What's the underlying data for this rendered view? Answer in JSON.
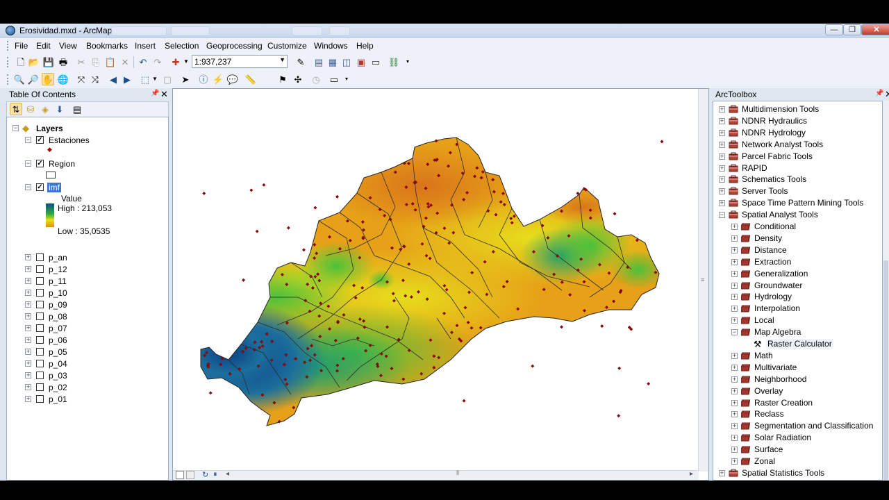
{
  "window": {
    "title": "Erosividad.mxd - ArcMap",
    "minimize": "0",
    "maximize": "1",
    "close": "r"
  },
  "menu": [
    "File",
    "Edit",
    "View",
    "Bookmarks",
    "Insert",
    "Selection",
    "Geoprocessing",
    "Customize",
    "Windows",
    "Help"
  ],
  "toolbar": {
    "scale": "1:937,237"
  },
  "toc": {
    "title": "Table Of Contents",
    "group": "Layers",
    "layers": [
      {
        "name": "Estaciones",
        "checked": true
      },
      {
        "name": "Region",
        "checked": true
      },
      {
        "name": "imf",
        "checked": true,
        "legend": {
          "field": "Value",
          "high": "High : 213,053",
          "low": "Low : 35,0535"
        }
      }
    ],
    "other_layers": [
      "p_an",
      "p_12",
      "p_11",
      "p_10",
      "p_09",
      "p_08",
      "p_07",
      "p_06",
      "p_05",
      "p_04",
      "p_03",
      "p_02",
      "p_01"
    ]
  },
  "arctoolbox": {
    "title": "ArcToolbox",
    "toolboxes_top": [
      "Multidimension Tools",
      "NDNR Hydraulics",
      "NDNR Hydrology",
      "Network Analyst Tools",
      "Parcel Fabric Tools",
      "RAPID",
      "Schematics Tools",
      "Server Tools",
      "Space Time Pattern Mining Tools"
    ],
    "spatial_analyst": "Spatial Analyst Tools",
    "sa_before": [
      "Conditional",
      "Density",
      "Distance",
      "Extraction",
      "Generalization",
      "Groundwater",
      "Hydrology",
      "Interpolation",
      "Local"
    ],
    "map_algebra": "Map Algebra",
    "raster_calculator": "Raster Calculator",
    "sa_after": [
      "Math",
      "Multivariate",
      "Neighborhood",
      "Overlay",
      "Raster Creation",
      "Reclass",
      "Segmentation and Classification",
      "Solar Radiation",
      "Surface",
      "Zonal"
    ],
    "toolboxes_bottom": [
      "Spatial Statistics Tools"
    ]
  },
  "colors": {
    "legend_high": "#0a4f8a",
    "legend_mid": "#2fae3a",
    "legend_low": "#e08a10",
    "station": "#a00000"
  },
  "icons": [
    "search-icon",
    "pan-icon",
    "identify-icon",
    "pin-icon",
    "close-icon"
  ]
}
